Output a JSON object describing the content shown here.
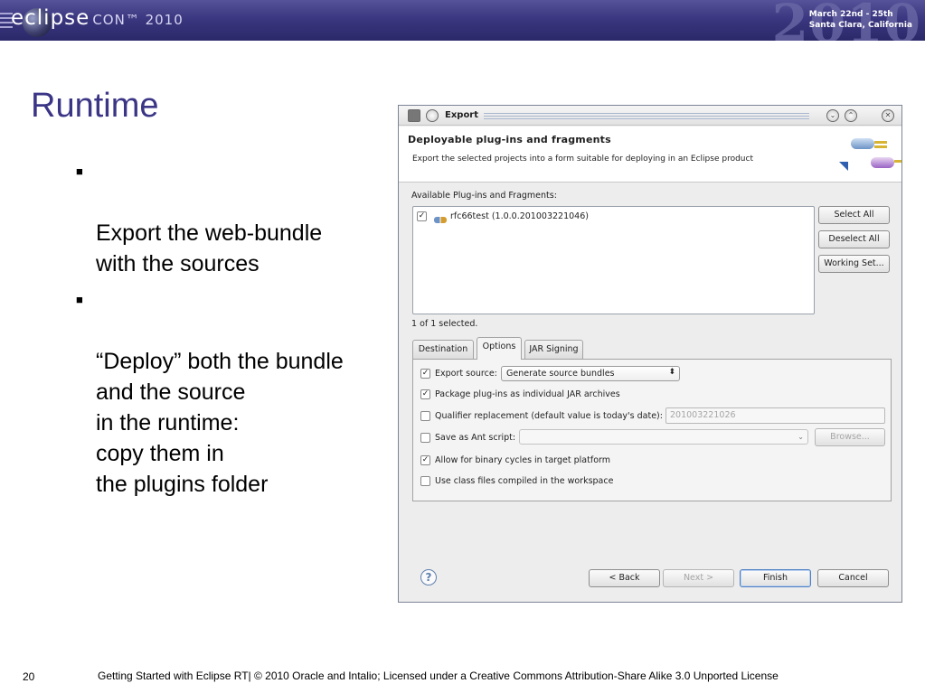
{
  "banner": {
    "logo_word": "eclipse",
    "logo_con": "CON™ 2010",
    "year_big": "2010",
    "date_line1": "March 22nd - 25th",
    "date_line2": "Santa Clara, California"
  },
  "slide": {
    "title": "Runtime",
    "bullet_marker": "■",
    "bullets": [
      "Export the web-bundle\n with the sources",
      "“Deploy” both the bundle\nand the source\nin the runtime:\ncopy them in\nthe plugins folder"
    ],
    "page_number": "20",
    "footer": "Getting Started with Eclipse RT|  © 2010 Oracle and Intalio; Licensed under a Creative Commons Attribution-Share Alike 3.0 Unported License"
  },
  "dialog": {
    "title": "Export",
    "header_title": "Deployable plug-ins and fragments",
    "header_description": "Export the selected projects into a form suitable for deploying in an Eclipse product",
    "available_label": "Available Plug-ins and Fragments:",
    "plugins": [
      {
        "label": "rfc66test (1.0.0.201003221046)",
        "checked": true
      }
    ],
    "selected_count": "1 of 1 selected.",
    "buttons": {
      "select_all": "Select All",
      "deselect_all": "Deselect All",
      "working_set": "Working Set...",
      "back": "< Back",
      "next": "Next >",
      "finish": "Finish",
      "cancel": "Cancel",
      "browse": "Browse..."
    },
    "tabs": [
      "Destination",
      "Options",
      "JAR Signing"
    ],
    "active_tab": "Options",
    "options": {
      "export_source_label": "Export source:",
      "export_source_value": "Generate source bundles",
      "package_label": "Package plug-ins as individual JAR archives",
      "qualifier_label": "Qualifier replacement (default value is today's date):",
      "qualifier_value": "201003221026",
      "ant_label": "Save as Ant script:",
      "binary_cycles_label": "Allow for binary cycles in target platform",
      "class_files_label": "Use class files compiled in the workspace"
    },
    "colors": {
      "accent": "#4d7fc4",
      "title": "#3b3586"
    }
  }
}
